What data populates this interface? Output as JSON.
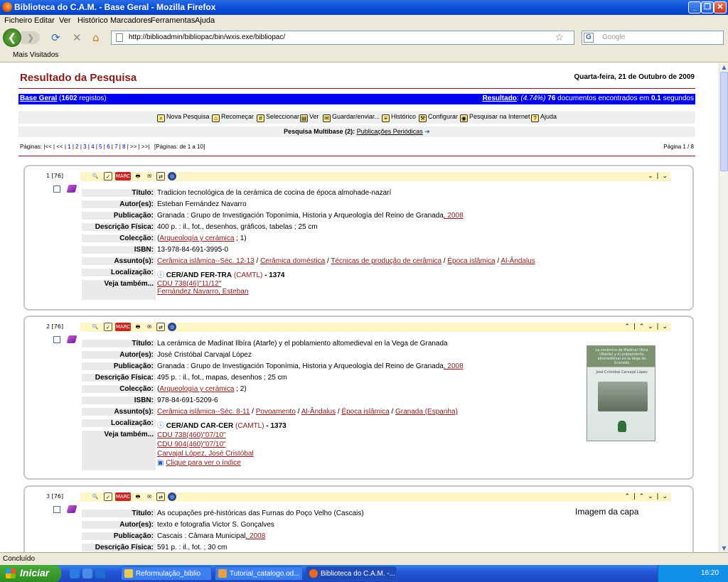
{
  "window": {
    "title": "Biblioteca do C.A.M. - Base Geral - Mozilla Firefox"
  },
  "menu": [
    "Ficheiro",
    "Editar",
    "Ver",
    "Histórico",
    "Marcadores",
    "Ferramentas",
    "Ajuda"
  ],
  "address": {
    "url": "http://biblioadmin/bibliopac/bin/wxis.exe/bibliopac/",
    "search_placeholder": "Google"
  },
  "bookmarks": {
    "item": "Mais Visitados"
  },
  "page": {
    "title": "Resultado da Pesquisa",
    "date_prefix": "Quarta-feira, 21 de ",
    "date_month": "Outubro",
    "date_suffix": " de 2009",
    "base_label": "Base Geral",
    "base_count": "1602",
    "base_suffix": " registos)",
    "result_label": "Resultado",
    "result_pct": " (4.74%) ",
    "result_count": "76",
    "result_mid": " documentos encontrados em ",
    "result_time": "0.1",
    "result_unit": " segundos",
    "tools": [
      "Nova Pesquisa",
      "Recomeçar",
      "Seleccionar",
      "Ver",
      "Guardar/enviar...",
      "Histórico",
      "Configurar",
      "Pesquisar na Internet",
      "Ajuda"
    ],
    "multibase_label": "Pesquisa Multibase (2):",
    "multibase_link": "Publicações Periódicas",
    "pages_label": "Páginas:",
    "pages": [
      "1",
      "2",
      "3",
      "4",
      "5",
      "6",
      "7",
      "8"
    ],
    "pages_info": "[Páginas: de 1 a 10]",
    "page_indicator": "Página 1 / 8"
  },
  "records": [
    {
      "num": "1",
      "total": "[76]",
      "titulo": "Tradicion tecnológica de la cerámica de cocina de época almohade-nazarí",
      "autor": "Esteban Fernández Navarro",
      "pub": "Granada : Grupo de Investigación Toponímia, Historia y Arqueología del Reino de Granada",
      "pub_year": ", 2008",
      "desc": "400 p. : il., fot., desenhos, gráficos, tabelas ; 25 cm",
      "colec_link": "Arqueología y cerámica",
      "colec_num": " ; 1)",
      "isbn": "13-978-84-691-3995-0",
      "assuntos": [
        "Cerâmica islâmica--Séc. 12-13",
        "Cerâmica doméstica",
        "Técnicas de produção de cerâmica",
        "Época islâmica",
        "Al-Ândalus"
      ],
      "local_code": "CER/AND FER-TRA",
      "local_lib": "(CAMTL)",
      "local_num": "- 1374",
      "veja": [
        "CDU 738(46)\"11/12\"",
        "Fernández Navarro, Esteban"
      ]
    },
    {
      "num": "2",
      "total": "[76]",
      "titulo": "La cerámica de Madínat Ilbíra (Atarfe) y el poblamiento altomedieval en la Vega de Granada",
      "autor": "José Cristóbal Carvajal López",
      "pub": "Granada : Grupo de Investigación Toponímia, Historia y Arqueología del Reino de Granada",
      "pub_year": ", 2008",
      "desc": "495 p. : il., fot., mapas, desenhos ; 25 cm",
      "colec_link": "Arqueología y cerámica",
      "colec_num": " ; 2)",
      "isbn": "978-84-691-5209-6",
      "assuntos": [
        "Cerâmica islâmica--Séc. 8-11",
        "Povoamento",
        "Al-Ândalus",
        "Época islâmica",
        "Granada (Espanha)"
      ],
      "local_code": "CER/AND CAR-CER",
      "local_lib": "(CAMTL)",
      "local_num": "- 1373",
      "veja": [
        "CDU 738(460)\"07/10\"",
        "CDU 904(460)\"07/10\"",
        "Carvajal López, José Cristóbal"
      ],
      "indice": "Clique para ver o índice",
      "cover_title": "La cerámica de Madínat Ilbíra (Atarfe) y el poblamiento altomedieval en la Vega de Granada",
      "cover_author": "José Cristóbal Carvajal López"
    },
    {
      "num": "3",
      "total": "[76]",
      "titulo": "As ocupações pré-históricas das Furnas do Poço Velho (Cascais)",
      "autor": "texto e fotografia Victor S. Gonçalves",
      "pub": "Cascais : Câmara Municipal",
      "pub_year": ", 2008",
      "desc": "591 p. : il., fot. ; 30 cm",
      "capa": "Imagem da capa"
    }
  ],
  "labels": {
    "titulo": "Título:",
    "autor": "Autor(es):",
    "pub": "Publicação:",
    "desc": "Descrição Física:",
    "colec": "Colecção:",
    "isbn": "ISBN:",
    "assunto": "Assunto(s):",
    "local": "Localização:",
    "veja": "Veja também..."
  },
  "status": {
    "text": "Concluído"
  },
  "taskbar": {
    "start": "Iniciar",
    "tasks": [
      "Reformulação_biblio",
      "Tutorial_catalogo.od...",
      "Biblioteca do C.A.M. -..."
    ],
    "clock": "16:20"
  }
}
